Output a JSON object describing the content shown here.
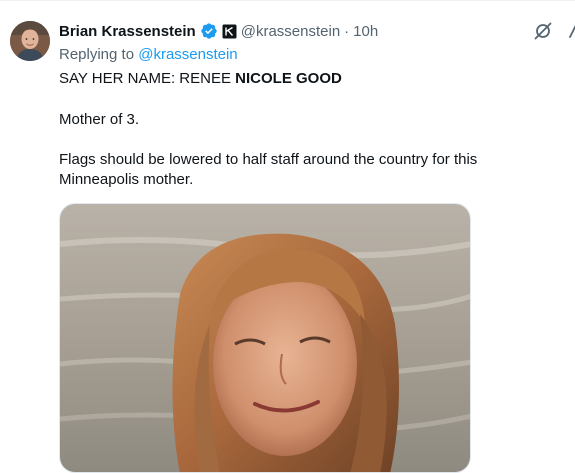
{
  "tweet": {
    "display_name": "Brian Krassenstein",
    "handle": "@krassenstein",
    "separator": "·",
    "time": "10h",
    "replying_prefix": "Replying to",
    "replying_handle": "@krassenstein",
    "text_line1_prefix": "SAY HER NAME:  RENEE ",
    "text_line1_bold": "NICOLE GOOD",
    "text_line2": "Mother of 3.",
    "text_line3": "Flags should be lowered to half staff around the country for this Minneapolis mother."
  },
  "icons": {
    "verified": "verified-badge-icon",
    "affiliate": "affiliate-badge-icon",
    "grok": "grok-icon",
    "more": "more-icon"
  },
  "colors": {
    "primary_text": "#0f1419",
    "secondary_text": "#536471",
    "link": "#1d9bf0",
    "verified": "#1d9bf0"
  }
}
